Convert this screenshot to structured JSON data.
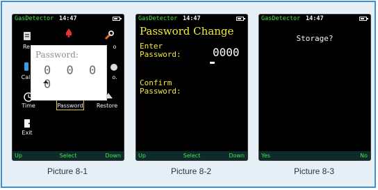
{
  "colors": {
    "border_accent": "#3c90cf",
    "panel_bg": "#e6eef6",
    "status_green": "#44e64a",
    "title_yellow": "#f2ea3a",
    "selection_outline": "#d9c443"
  },
  "screens": [
    {
      "status_app": "GasDetector",
      "status_time": "14:47",
      "menu": [
        {
          "label": "Re",
          "icon": "recording-icon"
        },
        {
          "label": "",
          "icon": "alarm-icon"
        },
        {
          "label": "o",
          "icon": "tools-icon"
        },
        {
          "label": "Cal",
          "icon": "calibration-icon"
        },
        {
          "label": "o.",
          "icon": "info-icon"
        },
        {
          "label": "Time",
          "icon": "clock-icon"
        },
        {
          "label": "Password",
          "icon": "lock-icon",
          "selected": true
        },
        {
          "label": "Restore",
          "icon": "restore-icon"
        },
        {
          "label": "Exit",
          "icon": "exit-icon"
        }
      ],
      "popup": {
        "label": "Password:",
        "digits": "0 0 0 0"
      },
      "softkeys": {
        "left": "Up",
        "middle": "Select",
        "right": "Down"
      },
      "caption": "Picture 8-1"
    },
    {
      "status_app": "GasDetector",
      "status_time": "14:47",
      "title": "Password Change",
      "enter_label_1": "Enter",
      "enter_label_2": "Password:",
      "digits": "0000",
      "confirm_label_1": "Confirm",
      "confirm_label_2": "Password:",
      "softkeys": {
        "left": "Up",
        "middle": "Select",
        "right": "Down"
      },
      "caption": "Picture 8-2"
    },
    {
      "status_app": "GasDetector",
      "status_time": "14:47",
      "prompt": "Storage?",
      "softkeys": {
        "left": "Yes",
        "right": "No"
      },
      "caption": "Picture 8-3"
    }
  ]
}
